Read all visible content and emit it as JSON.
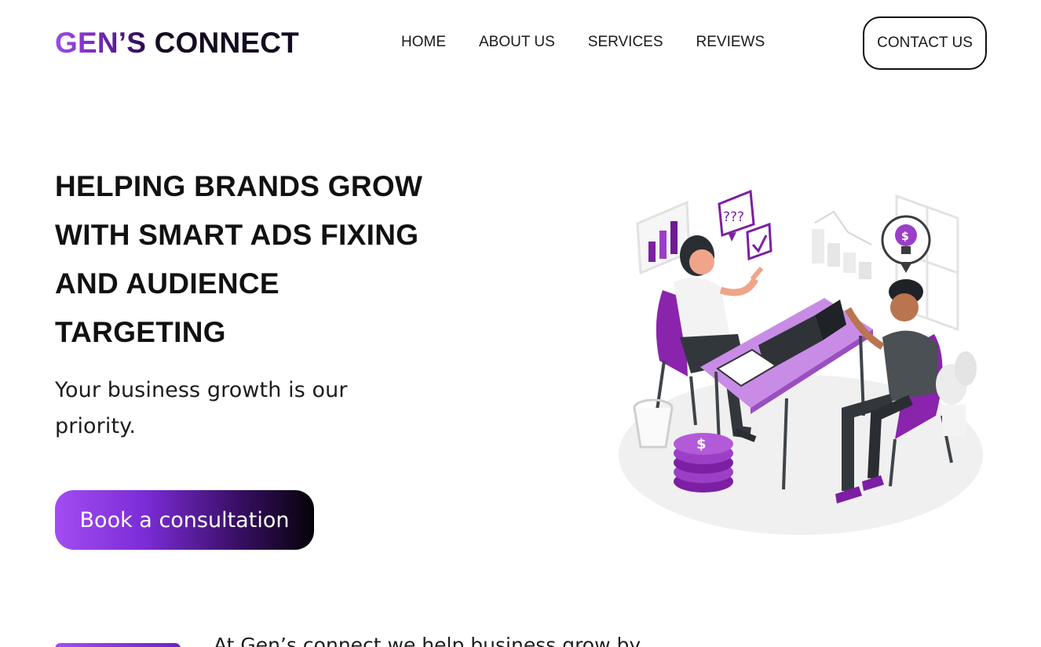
{
  "header": {
    "logo_part1": "GEN’S",
    "logo_part2": "CONNECT",
    "nav": [
      {
        "label": "HOME"
      },
      {
        "label": "ABOUT US"
      },
      {
        "label": "SERVICES"
      },
      {
        "label": "REVIEWS"
      }
    ],
    "contact_label": "CONTACT US"
  },
  "hero": {
    "title_lines": [
      "HELPING BRANDS GROW",
      "WITH SMART ADS FIXING",
      "AND AUDIENCE",
      "TARGETING"
    ],
    "subtitle_lines": [
      "Your business growth is our",
      "priority."
    ],
    "cta_label": "Book a consultation"
  },
  "illustration": {
    "question_bubble": "???",
    "lightbulb_symbol": "$",
    "coin_symbol": "$"
  },
  "bottom": {
    "text": "At Gen’s connect we help business grow by"
  },
  "colors": {
    "accent": "#9b4be6",
    "accent_dark": "#6d22c8",
    "text": "#111111",
    "table": "#c88ce6"
  }
}
